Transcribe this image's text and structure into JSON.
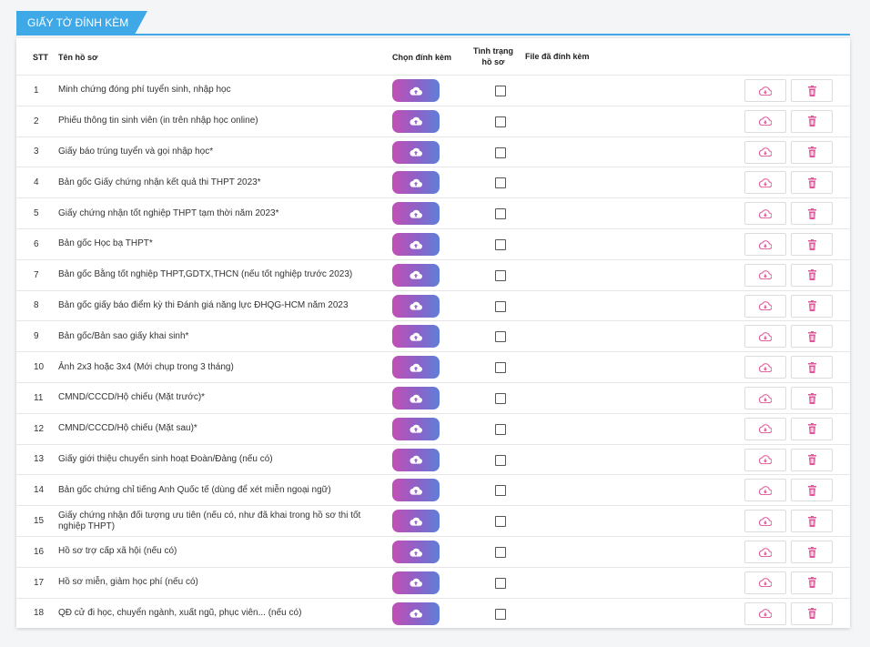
{
  "section": {
    "title": "GIẤY TỜ ĐÍNH KÈM"
  },
  "table": {
    "headers": {
      "stt": "STT",
      "name": "Tên hồ sơ",
      "attach": "Chọn đính kèm",
      "status_line1": "Tình trạng",
      "status_line2": "hồ sơ",
      "files": "File đã đính kèm"
    },
    "rows": [
      {
        "stt": "1",
        "name": "Minh chứng đóng phí tuyển sinh, nhập học"
      },
      {
        "stt": "2",
        "name": "Phiếu thông tin sinh viên (in trên nhập học online)"
      },
      {
        "stt": "3",
        "name": "Giấy báo trúng tuyển và gọi nhập học*"
      },
      {
        "stt": "4",
        "name": "Bản gốc Giấy chứng nhận kết quả thi THPT 2023*"
      },
      {
        "stt": "5",
        "name": "Giấy chứng nhận tốt nghiệp THPT tạm thời năm 2023*"
      },
      {
        "stt": "6",
        "name": "Bản gốc Học bạ THPT*"
      },
      {
        "stt": "7",
        "name": "Bản gốc Bằng tốt nghiệp THPT,GDTX,THCN (nếu tốt nghiệp trước 2023)"
      },
      {
        "stt": "8",
        "name": "Bản gốc giấy báo điểm kỳ thi Đánh giá năng lực ĐHQG-HCM năm 2023"
      },
      {
        "stt": "9",
        "name": "Bản gốc/Bản sao giấy khai sinh*"
      },
      {
        "stt": "10",
        "name": "Ảnh 2x3 hoặc 3x4 (Mới chụp trong 3 tháng)"
      },
      {
        "stt": "11",
        "name": "CMND/CCCD/Hộ chiếu (Mặt trước)*"
      },
      {
        "stt": "12",
        "name": "CMND/CCCD/Hộ chiếu (Mặt sau)*"
      },
      {
        "stt": "13",
        "name": "Giấy giới thiệu chuyển sinh hoạt Đoàn/Đảng (nếu có)"
      },
      {
        "stt": "14",
        "name": "Bản gốc chứng chỉ tiếng Anh Quốc tế (dùng để xét miễn ngoại ngữ)"
      },
      {
        "stt": "15",
        "name": "Giấy chứng nhận đối tượng ưu tiên (nếu có, như đã khai trong hồ sơ thi tốt nghiệp THPT)"
      },
      {
        "stt": "16",
        "name": "Hồ sơ trợ cấp xã hội (nếu có)"
      },
      {
        "stt": "17",
        "name": "Hồ sơ miễn, giảm học phí (nếu có)"
      },
      {
        "stt": "18",
        "name": "QĐ cử đi học, chuyển ngành, xuất ngũ, phục viên... (nếu có)"
      }
    ]
  },
  "icons": {
    "upload": "cloud-upload-icon",
    "download": "cloud-download-icon",
    "delete": "trash-icon"
  },
  "colors": {
    "accent": "#3fa8e6",
    "upload_gradient_start": "#c24fb5",
    "upload_gradient_end": "#5f7fd8",
    "action_icon": "#e0569a"
  }
}
